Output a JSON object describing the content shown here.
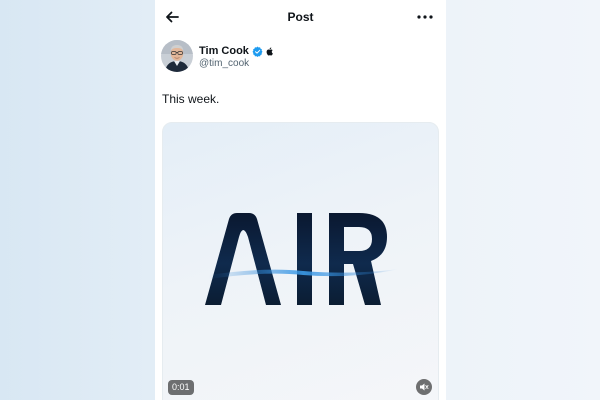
{
  "header": {
    "title": "Post",
    "back_icon": "arrow-left-icon",
    "more_icon": "more-horizontal-icon"
  },
  "post": {
    "author": {
      "name": "Tim Cook",
      "handle": "@tim_cook",
      "verified": true,
      "badge_icon": "apple-logo-icon"
    },
    "text": "This week.",
    "media": {
      "type": "video",
      "logo_text": "AIR",
      "timestamp": "0:01",
      "muted": true
    }
  },
  "colors": {
    "text_primary": "#0f1419",
    "text_secondary": "#536471",
    "verified_blue": "#1d9bf0",
    "logo_dark": "#0b1d33",
    "logo_accent": "#2a7fd0"
  }
}
